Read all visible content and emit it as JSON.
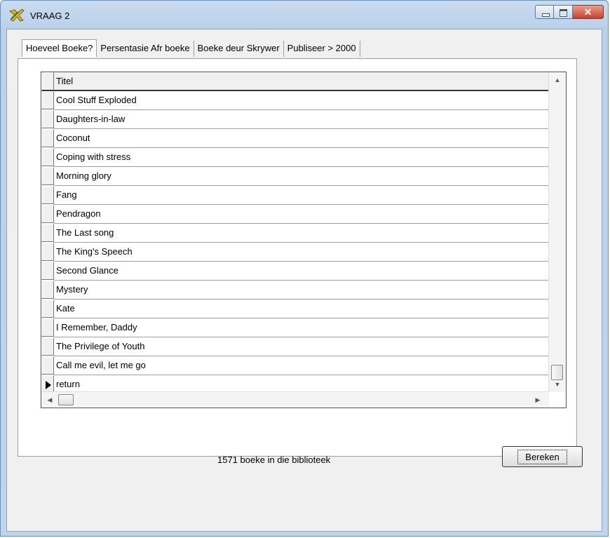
{
  "window": {
    "title": "VRAAG 2"
  },
  "tabs": [
    {
      "label": "Hoeveel Boeke?",
      "active": true
    },
    {
      "label": "Persentasie Afr boeke",
      "active": false
    },
    {
      "label": "Boeke deur Skrywer",
      "active": false
    },
    {
      "label": "Publiseer > 2000",
      "active": false
    }
  ],
  "grid": {
    "column_header": "Titel",
    "rows": [
      "Cool Stuff Exploded",
      "Daughters-in-law",
      "Coconut",
      "Coping with stress",
      "Morning glory",
      "Fang",
      "Pendragon",
      "The Last song",
      "The King's Speech",
      "Second Glance",
      "Mystery",
      "Kate",
      "I Remember, Daddy",
      "The Privilege of Youth",
      "Call me evil, let me go",
      "return"
    ],
    "current_row_index": 15
  },
  "status": {
    "text": "1571 boeke in die biblioteek"
  },
  "buttons": {
    "bereken_label": "Bereken"
  },
  "colors": {
    "titlebar": "#bfd5ec",
    "client": "#f0f0f0",
    "close_button": "#c8402a"
  }
}
